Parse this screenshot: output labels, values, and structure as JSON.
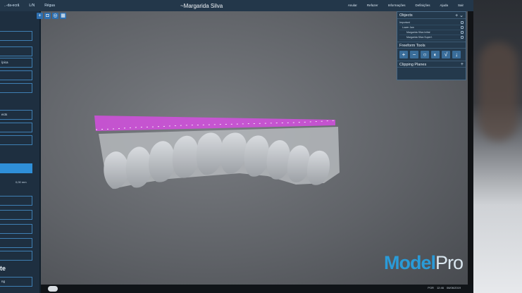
{
  "app": {
    "title": "~Margarida Silva",
    "brand_primary": "Model",
    "brand_secondary": "Pro"
  },
  "topbar": {
    "left_items": [
      "..-da-ecrã",
      "L/N",
      "Régua"
    ],
    "menu": [
      "Anular",
      "Refazer",
      "Informações",
      "Definições",
      "Ajuda",
      "Sair"
    ]
  },
  "left_panel": {
    "rows": [
      "",
      "",
      "ípica",
      "",
      "",
      "ects",
      "",
      "",
      "",
      "",
      "",
      "",
      "",
      "",
      ""
    ],
    "unit_value": "0,00 mm",
    "heading": "te",
    "bottom_field": "ng"
  },
  "objects_panel": {
    "title": "Objects",
    "items": [
      "Important",
      "Lower Jaw",
      "Margarida Silva Initial",
      "Margarida Silva Superf."
    ]
  },
  "freeform_panel": {
    "title": "Freeform Tools"
  },
  "clipping_panel": {
    "title": "Clipping Planes"
  },
  "taskbar": {
    "lang": "POR",
    "time": "12:46",
    "date": "06/06/2019"
  },
  "colors": {
    "accent": "#2a9bd8",
    "selection": "#d44fdf",
    "panel": "#24394c"
  }
}
